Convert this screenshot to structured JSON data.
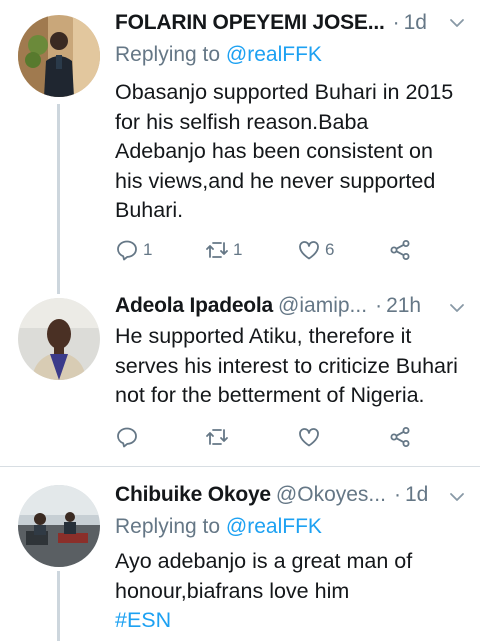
{
  "tweets": [
    {
      "name": "FOLARIN OPEYEMI JOSE...",
      "handle": "",
      "time": "1d",
      "replying_prefix": "Replying to ",
      "replying_to": "@realFFK",
      "lines": [
        "Obasanjo supported Buhari in 2015",
        "for his selfish reason.Baba",
        "Adebanjo has been consistent on",
        "his views,and he never supported",
        "Buhari."
      ],
      "replies": "1",
      "retweets": "1",
      "likes": "6"
    },
    {
      "name": "Adeola Ipadeola",
      "handle": "@iamip...",
      "time": "21h",
      "lines": [
        "He supported Atiku, therefore it",
        "serves his interest to criticize Buhari",
        "not for the betterment of Nigeria."
      ],
      "replies": "",
      "retweets": "",
      "likes": ""
    },
    {
      "name": "Chibuike Okoye",
      "handle": "@Okoyes...",
      "time": "1d",
      "replying_prefix": "Replying to ",
      "replying_to": "@realFFK",
      "lines": [
        "Ayo adebanjo is a great man of",
        "honour,biafrans love him"
      ],
      "hashtag": "#ESN"
    }
  ],
  "separator": "·",
  "icons": [
    "reply-icon",
    "retweet-icon",
    "like-icon",
    "share-icon",
    "chevron-down-icon"
  ],
  "colors": {
    "text": "#14171a",
    "muted": "#657786",
    "link": "#1da1f2",
    "thread": "#cdd6dd"
  }
}
